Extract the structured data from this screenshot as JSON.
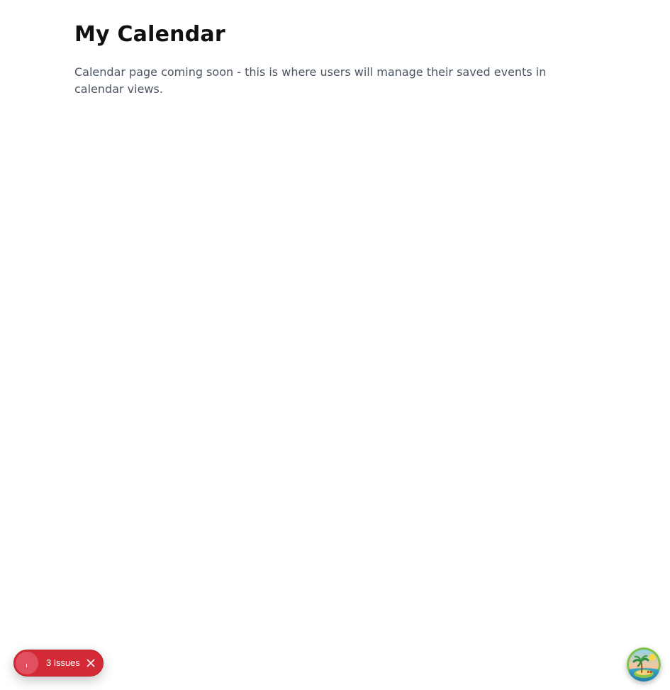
{
  "page": {
    "title": "My Calendar",
    "description": "Calendar page coming soon - this is where users will manage their saved events in calendar views."
  },
  "issues_badge": {
    "label": "3 Issues",
    "close_icon": "close-icon",
    "color": "#d42a36"
  },
  "avatar": {
    "icon": "tropical-island-icon"
  }
}
